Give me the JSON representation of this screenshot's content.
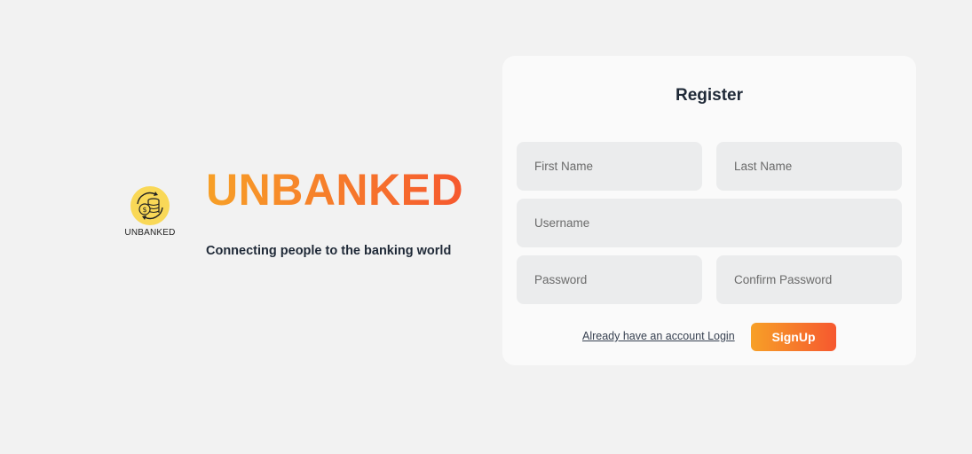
{
  "brand": {
    "logo_text": "UNBANKED",
    "title": "UNBANKED",
    "tagline": "Connecting people to the banking world",
    "logo_icon": "coins-exchange-icon"
  },
  "register": {
    "title": "Register",
    "fields": {
      "first_name": {
        "placeholder": "First Name",
        "value": ""
      },
      "last_name": {
        "placeholder": "Last Name",
        "value": ""
      },
      "username": {
        "placeholder": "Username",
        "value": ""
      },
      "password": {
        "placeholder": "Password",
        "value": ""
      },
      "confirm_password": {
        "placeholder": "Confirm Password",
        "value": ""
      }
    },
    "login_link": "Already have an account Login",
    "signup_label": "SignUp"
  },
  "colors": {
    "gradient_start": "#f7a027",
    "gradient_end": "#f6582f",
    "background": "#f2f2f2",
    "card": "#fafafa",
    "input": "#ebeced"
  }
}
